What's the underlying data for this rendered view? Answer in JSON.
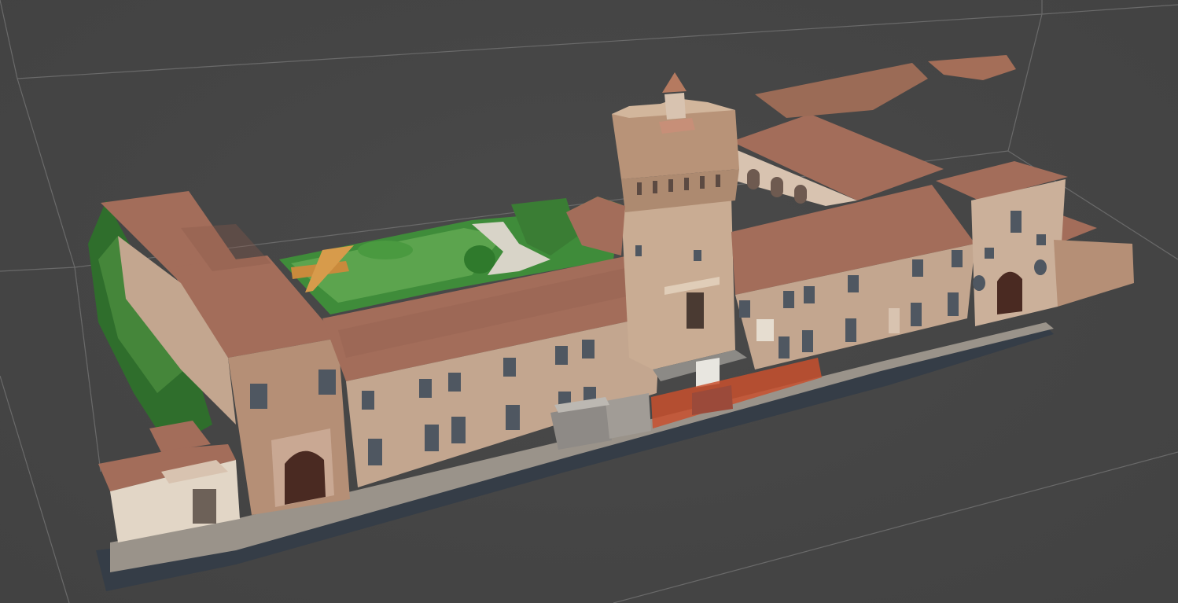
{
  "viewer": {
    "background": "#444444",
    "grid_color": "#6a6a6a",
    "object": "photogrammetry-mesh-castle",
    "icons": []
  },
  "palette": {
    "roof": "#a36d5a",
    "roof_dark": "#8a5a4a",
    "wall": "#c3a68f",
    "wall_light": "#d8c3b0",
    "brick": "#b58f76",
    "stone_light": "#e2d6c6",
    "garden": "#3f8c3a",
    "garden_light": "#5ca44e",
    "path": "#d8d4c8",
    "window": "#4f5761",
    "door": "#4a2a22",
    "shadow": "#353d47",
    "orange_panel": "#c8502e",
    "container": "#8e8a86"
  },
  "caption": ""
}
